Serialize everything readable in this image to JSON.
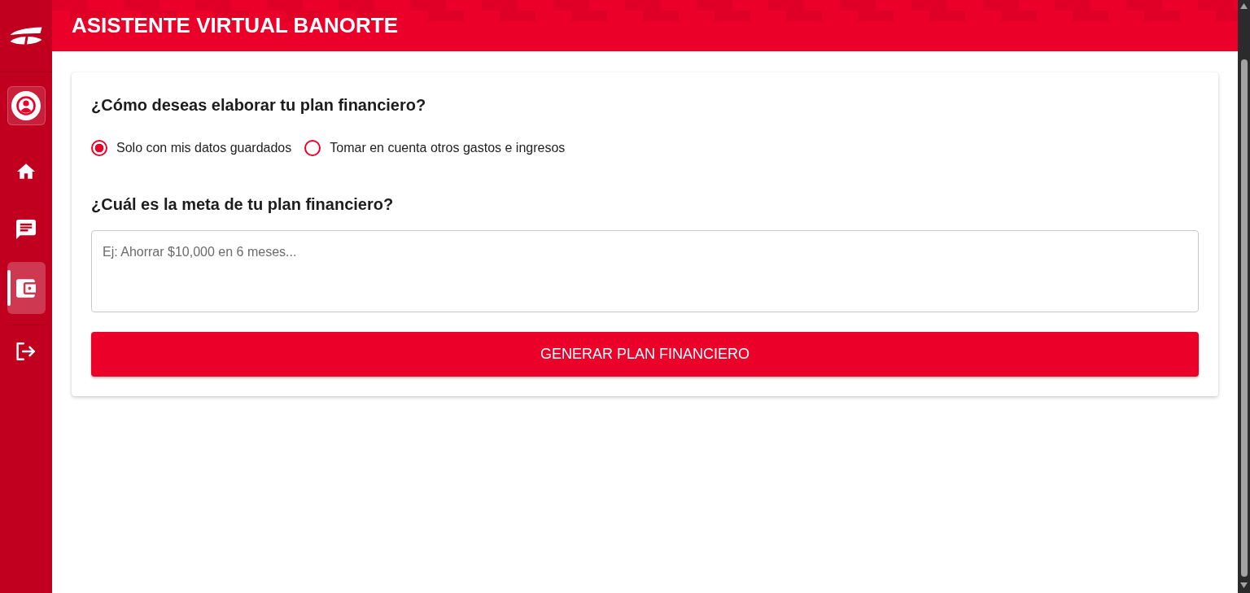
{
  "sidebar": {
    "items": [
      {
        "kind": "profile",
        "selected": false
      },
      {
        "kind": "home",
        "selected": false
      },
      {
        "kind": "chat",
        "selected": false
      },
      {
        "kind": "wallet",
        "selected": true
      },
      {
        "kind": "logout",
        "selected": false
      }
    ]
  },
  "header": {
    "title": "ASISTENTE VIRTUAL BANORTE"
  },
  "form": {
    "method_question": "¿Cómo deseas elaborar tu plan financiero?",
    "options": [
      {
        "label": "Solo con mis datos guardados",
        "selected": true
      },
      {
        "label": "Tomar en cuenta otros gastos e ingresos",
        "selected": false
      }
    ],
    "goal_question": "¿Cuál es la meta de tu plan financiero?",
    "goal_field": {
      "placeholder": "Ej: Ahorrar $10,000 en 6 meses..."
    },
    "submit_button": "GENERAR PLAN FINANCIERO"
  }
}
